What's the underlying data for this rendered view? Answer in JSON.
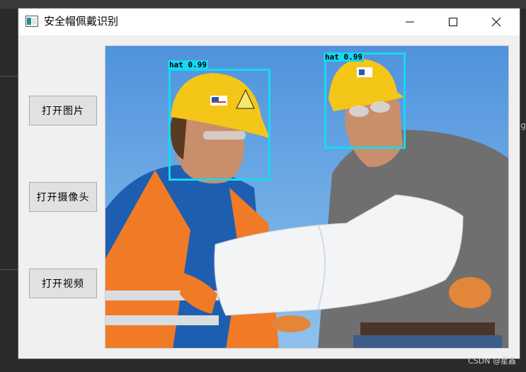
{
  "window": {
    "title": "安全帽佩戴识别",
    "icon": "app-window-icon"
  },
  "buttons": [
    {
      "label": "打开图片"
    },
    {
      "label": "打开摄像头"
    },
    {
      "label": "打开视频"
    }
  ],
  "detections": [
    {
      "label": "hat 0.99",
      "class": "hat",
      "confidence": 0.99
    },
    {
      "label": "hat 0.99",
      "class": "hat",
      "confidence": 0.99
    }
  ],
  "colors": {
    "detection_box": "#16d8f2",
    "sky": "#5c9fe0",
    "helmet": "#f4c618"
  },
  "watermark": "CSDN @星鑫",
  "edge_text": "g"
}
